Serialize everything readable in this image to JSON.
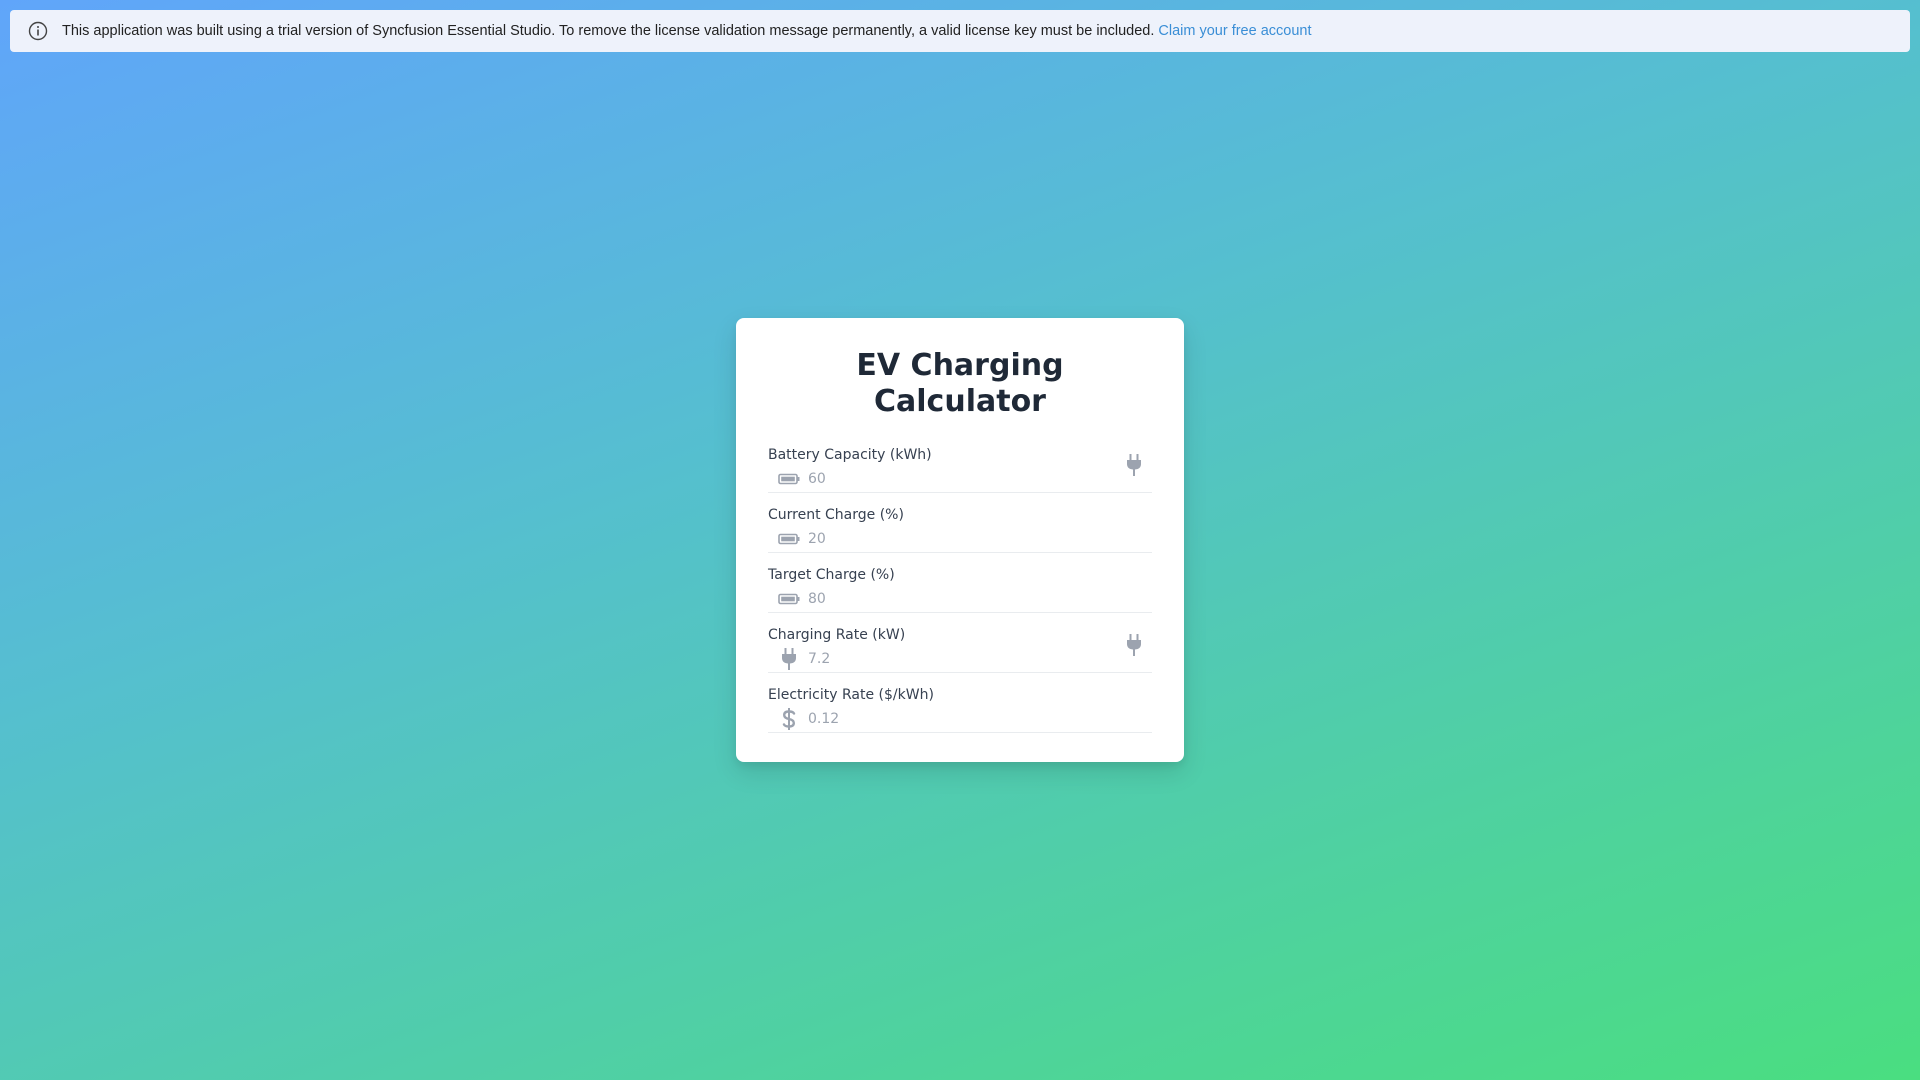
{
  "banner": {
    "message": "This application was built using a trial version of Syncfusion Essential Studio. To remove the license validation message permanently, a valid license key must be included.",
    "link_label": "Claim your free account",
    "icon": "info-icon"
  },
  "calculator": {
    "title": "EV Charging Calculator",
    "fields": [
      {
        "label": "Battery Capacity (kWh)",
        "value": "60",
        "icon": "battery-icon",
        "trailing_icon": "plug-icon"
      },
      {
        "label": "Current Charge (%)",
        "value": "20",
        "icon": "battery-icon"
      },
      {
        "label": "Target Charge (%)",
        "value": "80",
        "icon": "battery-icon"
      },
      {
        "label": "Charging Rate (kW)",
        "value": "7.2",
        "icon": "plug-icon",
        "trailing_icon": "plug-icon"
      },
      {
        "label": "Electricity Rate ($/kWh)",
        "value": "0.12",
        "icon": "dollar-icon"
      }
    ]
  },
  "colors": {
    "icon_gray": "#9ca3af",
    "link": "#3a8ed6",
    "title": "#1f2937"
  }
}
